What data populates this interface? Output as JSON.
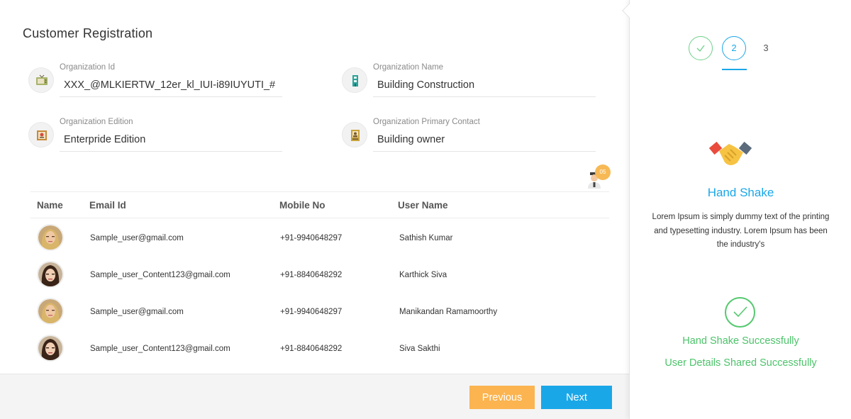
{
  "page_title": "Customer Registration",
  "fields": [
    {
      "label": "Organization Id",
      "value": "XXX_@MLKIERTW_12er_kl_IUI-i89IUYUTI_#",
      "icon": "tv-icon"
    },
    {
      "label": "Organization Name",
      "value": "Building Construction",
      "icon": "building-icon"
    },
    {
      "label": "Organization Edition",
      "value": "Enterpride Edition",
      "icon": "certificate-icon"
    },
    {
      "label": "Organization Primary Contact",
      "value": "Building owner",
      "icon": "contact-card-icon"
    }
  ],
  "user_count_badge": "05",
  "table": {
    "headers": [
      "Name",
      "Email Id",
      "Mobile No",
      "User Name"
    ],
    "rows": [
      {
        "avatar": "blonde-woman-avatar",
        "email": "Sample_user@gmail.com",
        "mobile": "+91-9940648297",
        "username": "Sathish Kumar"
      },
      {
        "avatar": "dark-hair-woman-avatar",
        "email": "Sample_user_Content123@gmail.com",
        "mobile": "+91-8840648292",
        "username": "Karthick Siva"
      },
      {
        "avatar": "blonde-woman-avatar",
        "email": "Sample_user@gmail.com",
        "mobile": "+91-9940648297",
        "username": "Manikandan Ramamoorthy"
      },
      {
        "avatar": "dark-hair-woman-avatar",
        "email": "Sample_user_Content123@gmail.com",
        "mobile": "+91-8840648292",
        "username": "Siva Sakthi"
      }
    ]
  },
  "buttons": {
    "previous": "Previous",
    "next": "Next"
  },
  "stepper": {
    "step1_icon": "check-icon",
    "step2": "2",
    "step3": "3",
    "active_step": 2
  },
  "side": {
    "title": "Hand Shake",
    "description": "Lorem Ipsum is simply dummy text of the printing and typesetting industry. Lorem Ipsum has been the industry's",
    "success_1": "Hand Shake Successfully",
    "success_2": "User Details Shared Successfully"
  },
  "colors": {
    "accent": "#1aa7e8",
    "success": "#4cc36a",
    "warning": "#fbb450",
    "badge": "#f7b955"
  }
}
